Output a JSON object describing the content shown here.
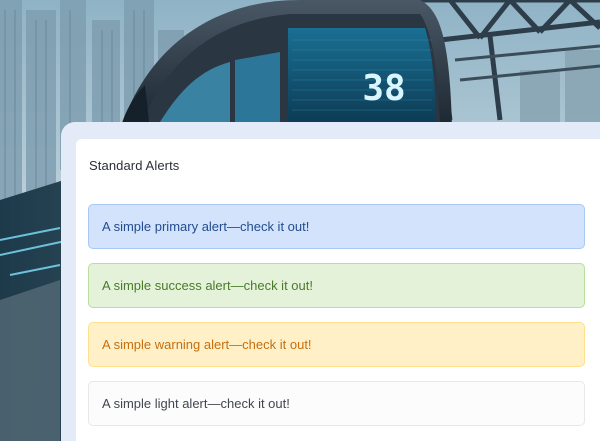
{
  "card": {
    "title": "Standard Alerts"
  },
  "alerts": [
    {
      "variant": "primary",
      "text": "A simple primary alert—check it out!"
    },
    {
      "variant": "success",
      "text": "A simple success alert—check it out!"
    },
    {
      "variant": "warning",
      "text": "A simple warning alert—check it out!"
    },
    {
      "variant": "light",
      "text": "A simple light alert—check it out!"
    }
  ],
  "background": {
    "train_display_number": "38"
  },
  "colors": {
    "panel_bg": "#e4ebf8",
    "primary_bg": "#d2e3fb",
    "success_bg": "#e3f2d9",
    "warning_bg": "#fff0c7",
    "light_bg": "#fcfcfd"
  }
}
